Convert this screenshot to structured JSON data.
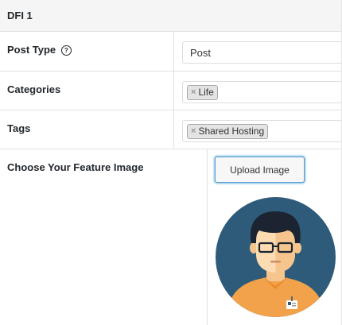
{
  "panel": {
    "title": "DFI 1"
  },
  "fields": {
    "post_type": {
      "label": "Post Type",
      "help_icon": "question-circle-icon",
      "value": "Post"
    },
    "categories": {
      "label": "Categories",
      "chips": [
        {
          "remove": "×",
          "label": "Life"
        }
      ]
    },
    "tags": {
      "label": "Tags",
      "chips": [
        {
          "remove": "×",
          "label": "Shared Hosting"
        }
      ]
    },
    "feature_image": {
      "label": "Choose Your Feature Image",
      "button_label": "Upload Image",
      "preview_icon": "user-avatar-illustration"
    }
  },
  "colors": {
    "avatar_background": "#2e5b7a",
    "shirt": "#f2a24b",
    "skin": "#fddcb2",
    "hair": "#1c2431",
    "button_focus": "#5b9dd9"
  }
}
